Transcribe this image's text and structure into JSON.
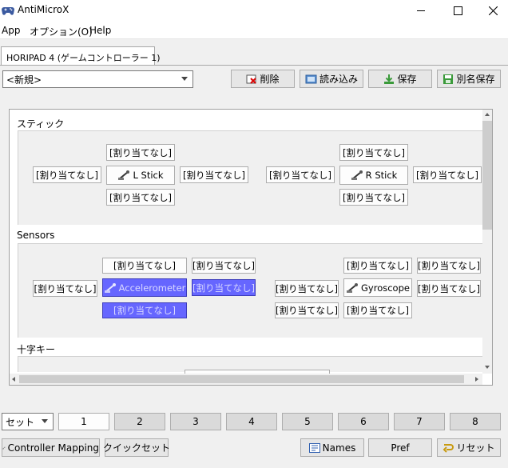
{
  "window": {
    "title": "AntiMicroX"
  },
  "menu": [
    {
      "label": "App"
    },
    {
      "label": "オプション(O)"
    },
    {
      "label": "Help"
    }
  ],
  "tab": {
    "label": "HORIPAD 4 (ゲームコントローラー 1)"
  },
  "profile": {
    "selected": "<新規>"
  },
  "toolbar": {
    "delete": "削除",
    "load": "読み込み",
    "save": "保存",
    "save_as": "別名保存"
  },
  "groups": {
    "stick": {
      "title": "スティック"
    },
    "sensors": {
      "title": "Sensors"
    },
    "dpad": {
      "title": "十字キー"
    }
  },
  "unassigned": "[割り当てなし]",
  "stick_buttons": {
    "l_stick": "L Stick",
    "r_stick": "R Stick"
  },
  "sensor_buttons": {
    "accelerometer": "Accelerometer",
    "gyroscope": "Gyroscope"
  },
  "sets": {
    "label": "セット",
    "numbers": [
      "1",
      "2",
      "3",
      "4",
      "5",
      "6",
      "7",
      "8"
    ]
  },
  "bottom": {
    "controller_mapping": "Controller Mapping",
    "quick_set": "クイックセット",
    "names": "Names",
    "pref": "Pref",
    "reset": "リセット"
  }
}
